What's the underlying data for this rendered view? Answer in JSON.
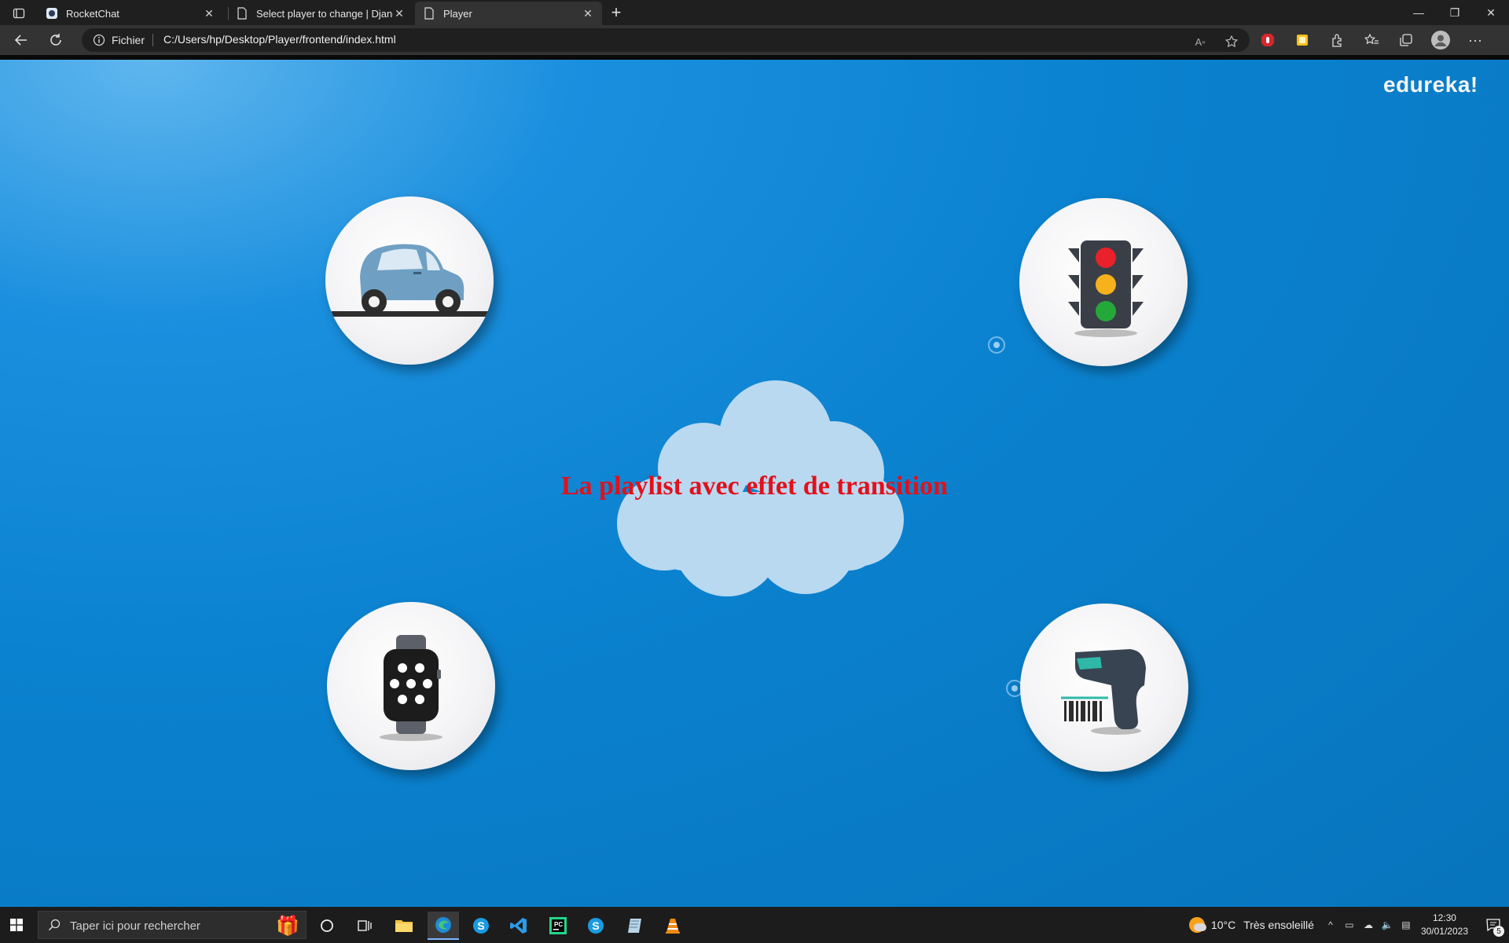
{
  "browser": {
    "tabs": [
      {
        "label": "RocketChat",
        "icon": "rocketchat-icon",
        "active": false
      },
      {
        "label": "Select player to change | Django",
        "icon": "page-icon",
        "active": false
      },
      {
        "label": "Player",
        "icon": "page-icon",
        "active": true
      }
    ],
    "address": {
      "info_label": "Fichier",
      "url": "C:/Users/hp/Desktop/Player/frontend/index.html"
    }
  },
  "page": {
    "title": "La playlist avec effet de transition",
    "logo": "edureka!",
    "items": [
      {
        "name": "car",
        "icon": "car-icon"
      },
      {
        "name": "traffic-light",
        "icon": "traffic-light-icon"
      },
      {
        "name": "smartwatch",
        "icon": "smartwatch-icon"
      },
      {
        "name": "barcode-scanner",
        "icon": "barcode-scanner-icon"
      }
    ],
    "colors": {
      "title": "#e3101a",
      "background": "#0b82cf",
      "cloud": "#b9d9f1"
    }
  },
  "taskbar": {
    "search_placeholder": "Taper ici pour rechercher",
    "weather": {
      "temp": "10°C",
      "condition": "Très ensoleillé"
    },
    "clock": {
      "time": "12:30",
      "date": "30/01/2023"
    },
    "notifications": "5"
  }
}
